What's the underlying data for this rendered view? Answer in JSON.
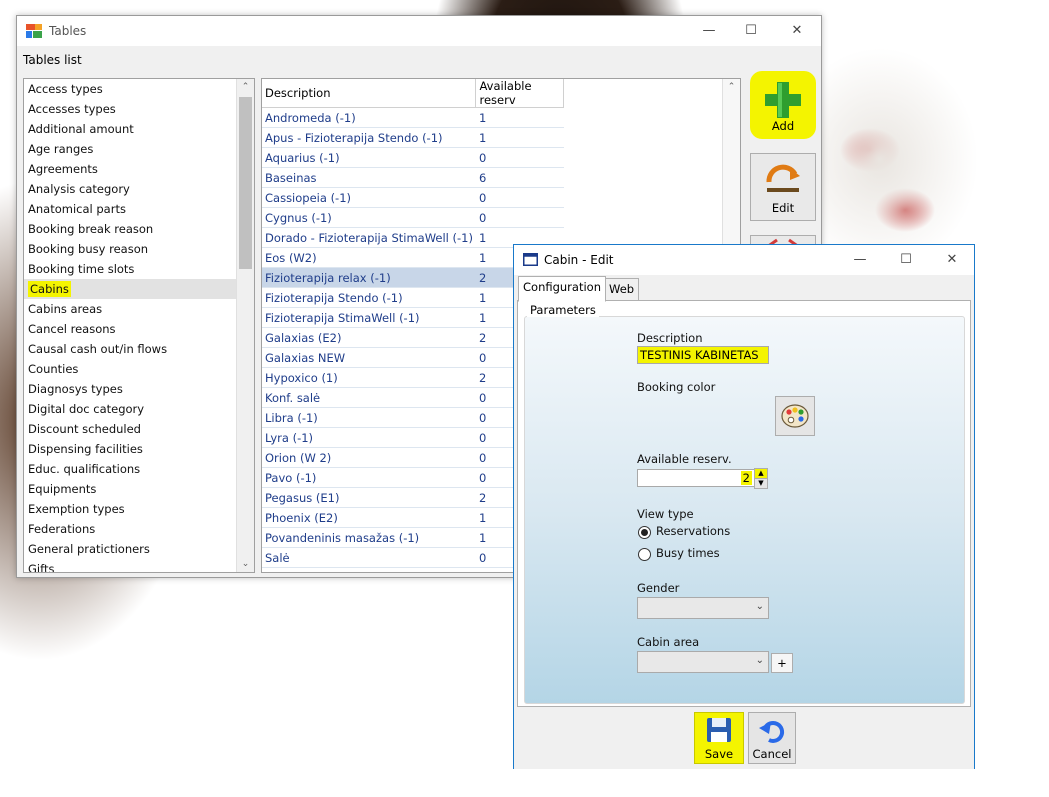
{
  "main_window": {
    "title": "Tables",
    "section_label": "Tables list",
    "min_glyph": "—",
    "max_glyph": "☐",
    "close_glyph": "✕",
    "scroll_up": "⌃",
    "scroll_down": "⌄"
  },
  "tables_list": {
    "items": [
      "Access types",
      "Accesses types",
      "Additional amount",
      "Age ranges",
      "Agreements",
      "Analysis category",
      "Anatomical parts",
      "Booking break reason",
      "Booking busy reason",
      "Booking time slots",
      "Cabins",
      "Cabins areas",
      "Cancel reasons",
      "Causal cash out/in flows",
      "Counties",
      "Diagnosys types",
      "Digital doc category",
      "Discount scheduled",
      "Dispensing facilities",
      "Educ. qualifications",
      "Equipments",
      "Exemption types",
      "Federations",
      "General pratictioners",
      "Gifts"
    ],
    "selected_index": 10
  },
  "grid": {
    "columns": [
      "Description",
      "Available reserv"
    ],
    "rows": [
      [
        "Andromeda (-1)",
        "1"
      ],
      [
        "Apus - Fizioterapija Stendo (-1)",
        "1"
      ],
      [
        "Aquarius (-1)",
        "0"
      ],
      [
        "Baseinas",
        "6"
      ],
      [
        "Cassiopeia (-1)",
        "0"
      ],
      [
        "Cygnus (-1)",
        "0"
      ],
      [
        "Dorado - Fizioterapija StimaWell (-1)",
        "1"
      ],
      [
        "Eos (W2)",
        "1"
      ],
      [
        "Fizioterapija relax (-1)",
        "2"
      ],
      [
        "Fizioterapija Stendo (-1)",
        "1"
      ],
      [
        "Fizioterapija StimaWell (-1)",
        "1"
      ],
      [
        "Galaxias (E2)",
        "2"
      ],
      [
        "Galaxias NEW",
        "0"
      ],
      [
        "Hypoxico (1)",
        "2"
      ],
      [
        "Konf. salė",
        "0"
      ],
      [
        "Libra (-1)",
        "0"
      ],
      [
        "Lyra (-1)",
        "0"
      ],
      [
        "Orion (W 2)",
        "0"
      ],
      [
        "Pavo (-1)",
        "0"
      ],
      [
        "Pegasus (E1)",
        "2"
      ],
      [
        "Phoenix (E2)",
        "1"
      ],
      [
        "Povandeninis masažas (-1)",
        "1"
      ],
      [
        "Salė",
        "0"
      ]
    ],
    "selected_index": 8
  },
  "side_buttons": {
    "add_label": "Add",
    "edit_label": "Edit"
  },
  "edit_dialog": {
    "title": "Cabin - Edit",
    "min_glyph": "—",
    "max_glyph": "☐",
    "close_glyph": "✕",
    "tabs": [
      "Configuration",
      "Web"
    ],
    "group_title": "Parameters",
    "description_label": "Description",
    "description_value": "TESTINIS KABINETAS",
    "booking_color_label": "Booking color",
    "available_label": "Available reserv.",
    "available_value": "2",
    "view_type_label": "View type",
    "view_options": [
      "Reservations",
      "Busy times"
    ],
    "view_selected": "Reservations",
    "gender_label": "Gender",
    "gender_value": "",
    "cabin_area_label": "Cabin area",
    "cabin_area_value": "",
    "add_area_glyph": "+",
    "save_label": "Save",
    "cancel_label": "Cancel"
  },
  "colors": {
    "highlight": "#f4f400",
    "accent_blue": "#1979ca",
    "link_text": "#1f3d8a"
  }
}
